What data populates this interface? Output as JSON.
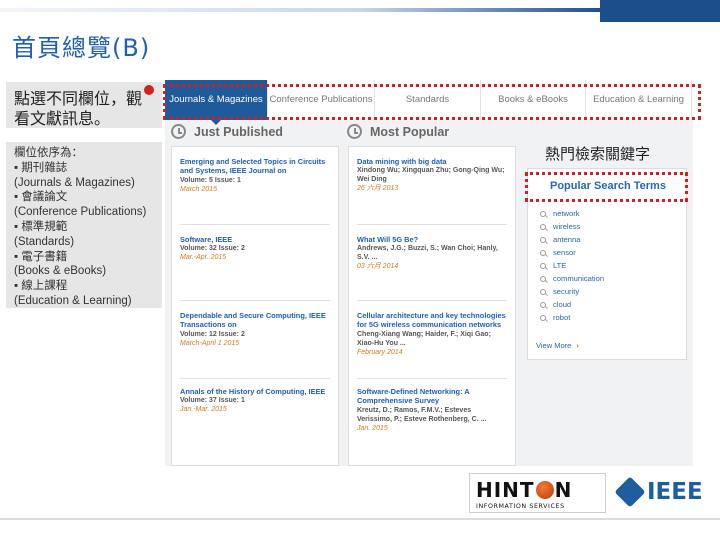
{
  "slide": {
    "title": "首頁總覽(B)"
  },
  "notes": {
    "instruction": "點選不同欄位，觀看文獻訊息。",
    "order_heading": "欄位依序為：",
    "order_items": [
      "▪ 期刊雜誌",
      "(Journals & Magazines)",
      "▪ 會議論文",
      "(Conference Publications)",
      "▪ 標準規範",
      "(Standards)",
      "▪ 電子書籍",
      "(Books & eBooks)",
      "▪ 線上課程",
      "(Education & Learning)"
    ]
  },
  "tabs": [
    {
      "label": "Journals & Magazines",
      "active": true
    },
    {
      "label": "Conference Publications",
      "active": false
    },
    {
      "label": "Standards",
      "active": false
    },
    {
      "label": "Books & eBooks",
      "active": false
    },
    {
      "label": "Education & Learning",
      "active": false
    }
  ],
  "just_published": {
    "heading": "Just Published",
    "items": [
      {
        "title": "Emerging and Selected Topics in Circuits and Systems, IEEE Journal on",
        "meta": "Volume: 5   Issue: 1",
        "date": "March 2015"
      },
      {
        "title": "Software, IEEE",
        "meta": "Volume: 32   Issue: 2",
        "date": "Mar.-Apr. 2015"
      },
      {
        "title": "Dependable and Secure Computing, IEEE Transactions on",
        "meta": "Volume: 12   Issue: 2",
        "date": "March-April 1 2015"
      },
      {
        "title": "Annals of the History of Computing, IEEE",
        "meta": "Volume: 37   Issue: 1",
        "date": "Jan.-Mar. 2015"
      }
    ]
  },
  "most_popular": {
    "heading": "Most Popular",
    "items": [
      {
        "title": "Data mining with big data",
        "meta": "Xindong Wu; Xingquan Zhu; Gong-Qing Wu; Wei Ding",
        "date": "26 六月 2013"
      },
      {
        "title": "What Will 5G Be?",
        "meta": "Andrews, J.G.; Buzzi, S.; Wan Choi; Hanly, S.V. ...",
        "date": "03 六月 2014"
      },
      {
        "title": "Cellular architecture and key technologies for 5G wireless communication networks",
        "meta": "Cheng-Xiang Wang; Haider, F.; Xiqi Gao; Xiao-Hu You ...",
        "date": "February 2014"
      },
      {
        "title": "Software-Defined Networking: A Comprehensive Survey",
        "meta": "Kreutz, D.; Ramos, F.M.V.; Esteves Verissimo, P.; Esteve Rothenberg, C. ...",
        "date": "Jan. 2015"
      }
    ]
  },
  "popular_search": {
    "label_zh": "熱門檢索關鍵字",
    "heading": "Popular Search Terms",
    "terms": [
      "network",
      "wireless",
      "antenna",
      "sensor",
      "LTE",
      "communication",
      "security",
      "cloud",
      "robot"
    ],
    "view_more": "View More"
  },
  "logos": {
    "hinton_word_left": "HINT",
    "hinton_word_right": "N",
    "hinton_sub": "INFORMATION SERVICES",
    "ieee": "IEEE"
  }
}
